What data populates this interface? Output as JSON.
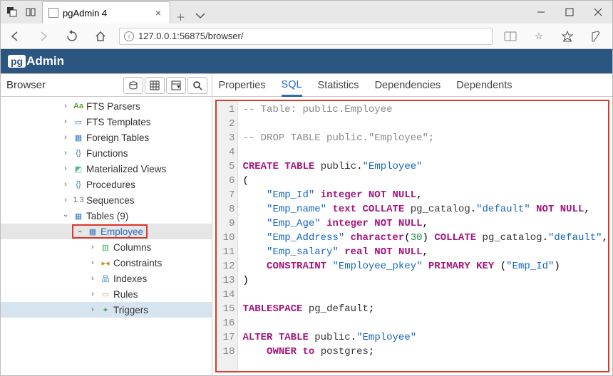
{
  "browser": {
    "tab_title": "pgAdmin 4",
    "url": "127.0.0.1:56875/browser/"
  },
  "pgadmin": {
    "logo_pg": "pg",
    "logo_text": "Admin",
    "browser_label": "Browser"
  },
  "tree": {
    "fts_parsers": "FTS Parsers",
    "fts_templates": "FTS Templates",
    "foreign_tables": "Foreign Tables",
    "functions": "Functions",
    "mat_views": "Materialized Views",
    "procedures": "Procedures",
    "sequences": "Sequences",
    "tables": "Tables (9)",
    "employee": "Employee",
    "columns": "Columns",
    "constraints": "Constraints",
    "indexes": "Indexes",
    "rules": "Rules",
    "triggers": "Triggers"
  },
  "tabs": {
    "properties": "Properties",
    "sql": "SQL",
    "statistics": "Statistics",
    "dependencies": "Dependencies",
    "dependents": "Dependents"
  },
  "sql": {
    "l1_comment": "-- Table: public.Employee",
    "l3_comment": "-- DROP TABLE public.\"Employee\";",
    "create": "CREATE",
    "table": "TABLE",
    "public": "public",
    "dot": ".",
    "employee_q": "\"Employee\"",
    "lparen": "(",
    "rparen": ")",
    "emp_id": "\"Emp_Id\"",
    "emp_name": "\"Emp_name\"",
    "emp_age": "\"Emp_Age\"",
    "emp_addr": "\"Emp_Address\"",
    "emp_sal": "\"Emp_salary\"",
    "integer": "integer",
    "text": "text",
    "character": "character",
    "thirty": "30",
    "real": "real",
    "not": "NOT",
    "null": "NULL",
    "collate": "COLLATE",
    "pg_default_q": "\"default\"",
    "pg_catalog": "pg_catalog",
    "constraint": "CONSTRAINT",
    "emp_pkey": "\"Employee_pkey\"",
    "primary": "PRIMARY",
    "key": "KEY",
    "tablespace": "TABLESPACE",
    "pg_default": "pg_default",
    "alter": "ALTER",
    "owner": "OWNER",
    "to": "to",
    "postgres": "postgres",
    "comma": ",",
    "semi": ";",
    "indent": "    "
  }
}
